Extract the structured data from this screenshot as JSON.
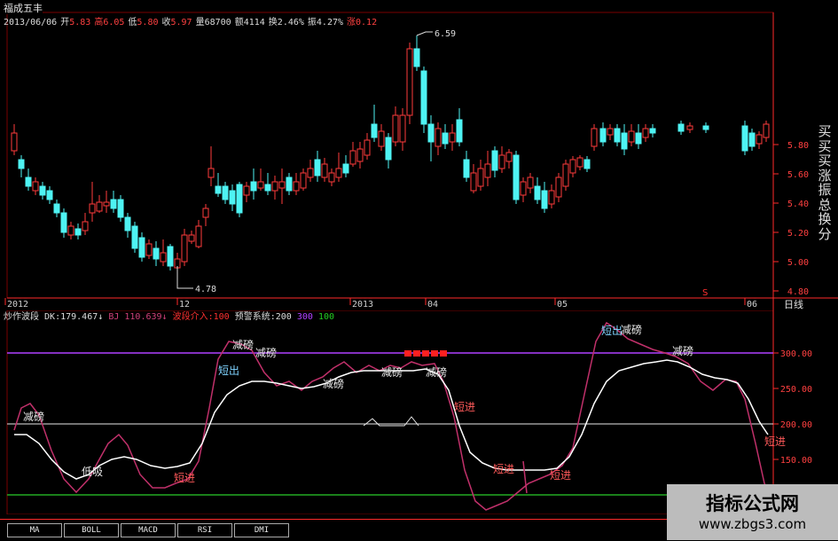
{
  "title": "福成五丰",
  "quote": {
    "date": "2013/06/06",
    "open_label": "开",
    "open": "5.83",
    "high_label": "高",
    "high": "6.05",
    "low_label": "低",
    "low": "5.80",
    "close_label": "收",
    "close": "5.97",
    "volume_label": "量",
    "volume": "68700",
    "amount_label": "额",
    "amount": "4114",
    "turnover_label": "换",
    "turnover": "2.46%",
    "amplitude_label": "振",
    "amplitude": "4.27%",
    "change_label": "涨",
    "change": "0.12"
  },
  "price_axis": [
    "5.80",
    "5.60",
    "5.40",
    "5.20",
    "5.00",
    "4.80"
  ],
  "price_annotations": {
    "high": "6.59",
    "low": "4.78"
  },
  "time_axis": [
    "2012",
    "12",
    "2013",
    "04",
    "05",
    "06"
  ],
  "period_label": "日线",
  "side_panel": [
    "买",
    "买",
    "买",
    "涨",
    "振",
    "总",
    "换",
    "分"
  ],
  "indicator": {
    "name": "炒作波段",
    "dk_label": "DK:",
    "dk": "179.467",
    "bj_label": "BJ",
    "bj": "110.639",
    "buy_label": "波段介入:",
    "buy": "100",
    "warn_label": "预警系统:",
    "warn_a": "200",
    "warn_b": "300",
    "warn_c": "100"
  },
  "indicator_axis": [
    "300.00",
    "250.00",
    "200.00",
    "150.00"
  ],
  "signals": {
    "reduce": "减磅",
    "short_out": "短出",
    "short_in": "短进",
    "low_absorb": "低吸"
  },
  "tabs": [
    "MA",
    "BOLL",
    "MACD",
    "RSI",
    "DMI"
  ],
  "watermark": {
    "title": "指标公式网",
    "url": "www.zbgs3.com"
  },
  "colors": {
    "up": "#ff3b3b",
    "down": "#4ef3f3",
    "grid": "#8b0000",
    "dk_line": "#ffffff",
    "bj_line": "#c0306a",
    "level300": "#b040ff",
    "level200": "#e8e8e8",
    "level100": "#22aa22"
  }
}
